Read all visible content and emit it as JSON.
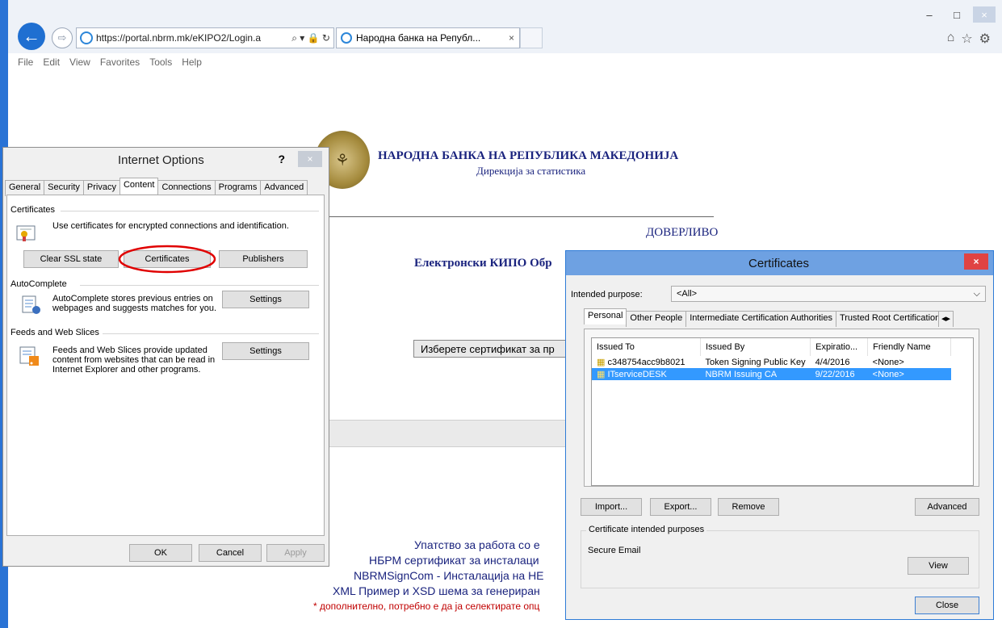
{
  "browser": {
    "address_url": "https://portal.nbrm.mk/eKIPO2/Login.a",
    "address_icons": "⌕ ▾ 🔒 ↻",
    "tab_title": "Народна банка на Републ...",
    "tab_close": "×",
    "menu": [
      "File",
      "Edit",
      "View",
      "Favorites",
      "Tools",
      "Help"
    ],
    "window_controls": {
      "minimize": "–",
      "maximize": "□",
      "close": "×"
    },
    "right_icons": {
      "home": "⌂",
      "favorites": "☆",
      "settings": "⚙"
    },
    "back_glyph": "←",
    "forward_glyph": "⇨"
  },
  "page": {
    "seal_glyph": "⚘",
    "bank_name": "НАРОДНА БАНКА НА РЕПУБЛИКА МАКЕДОНИЈА",
    "directorate": "Дирекција за статистика",
    "confidential": "ДОВЕРЛИВО",
    "app_title": "Електронски КИПО Обр",
    "select_certificate_button": "Изберете сертификат за пр",
    "links": [
      "Упатство за работа со е",
      "НБРМ сертификат за инсталаци",
      "NBRMSignCom - Инсталација на НЕ",
      "XML Пример и XSD шема за генериран"
    ],
    "note": "* дополнително, потребно е да ја селектирате опц"
  },
  "internet_options": {
    "title": "Internet Options",
    "help": "?",
    "close": "×",
    "tabs": [
      "General",
      "Security",
      "Privacy",
      "Content",
      "Connections",
      "Programs",
      "Advanced"
    ],
    "active_tab": "Content",
    "certificates_group": "Certificates",
    "certificates_desc": "Use certificates for encrypted connections and identification.",
    "clear_ssl": "Clear SSL state",
    "certificates_btn": "Certificates",
    "publishers_btn": "Publishers",
    "autocomplete_group": "AutoComplete",
    "autocomplete_desc": "AutoComplete stores previous entries on webpages and suggests matches for you.",
    "autocomplete_settings": "Settings",
    "feeds_group": "Feeds and Web Slices",
    "feeds_desc": "Feeds and Web Slices provide updated content from websites that can be read in Internet Explorer and other programs.",
    "feeds_settings": "Settings",
    "ok": "OK",
    "cancel": "Cancel",
    "apply": "Apply"
  },
  "certificates_dialog": {
    "title": "Certificates",
    "close": "×",
    "intended_purpose_label": "Intended purpose:",
    "intended_purpose_value": "<All>",
    "tabs": [
      "Personal",
      "Other People",
      "Intermediate Certification Authorities",
      "Trusted Root Certification"
    ],
    "active_tab": "Personal",
    "columns": [
      "Issued To",
      "Issued By",
      "Expiratio...",
      "Friendly Name"
    ],
    "rows": [
      {
        "issued_to": "c348754acc9b8021",
        "issued_by": "Token Signing Public Key",
        "expiration": "4/4/2016",
        "friendly": "<None>",
        "selected": false
      },
      {
        "issued_to": "ITserviceDESK",
        "issued_by": "NBRM Issuing CA",
        "expiration": "9/22/2016",
        "friendly": "<None>",
        "selected": true
      }
    ],
    "import": "Import...",
    "export": "Export...",
    "remove": "Remove",
    "advanced": "Advanced",
    "purposes_group": "Certificate intended purposes",
    "purposes_value": "Secure Email",
    "view": "View",
    "close_btn": "Close"
  },
  "colors": {
    "accent": "#2a73d5",
    "selection": "#3399ff",
    "highlight_circle": "#e00000",
    "page_text": "#1a237e"
  }
}
